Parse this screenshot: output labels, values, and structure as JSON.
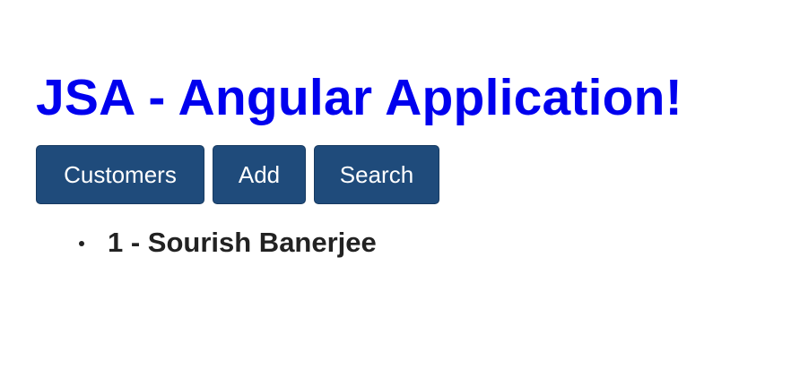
{
  "page": {
    "title": "JSA - Angular Application!"
  },
  "nav": {
    "buttons": [
      {
        "label": "Customers"
      },
      {
        "label": "Add"
      },
      {
        "label": "Search"
      }
    ]
  },
  "customers": {
    "items": [
      {
        "label": "1 - Sourish Banerjee"
      }
    ]
  },
  "colors": {
    "title": "#0000ee",
    "button_background": "#1f4b7b",
    "button_text": "#ffffff",
    "list_text": "#222222"
  }
}
